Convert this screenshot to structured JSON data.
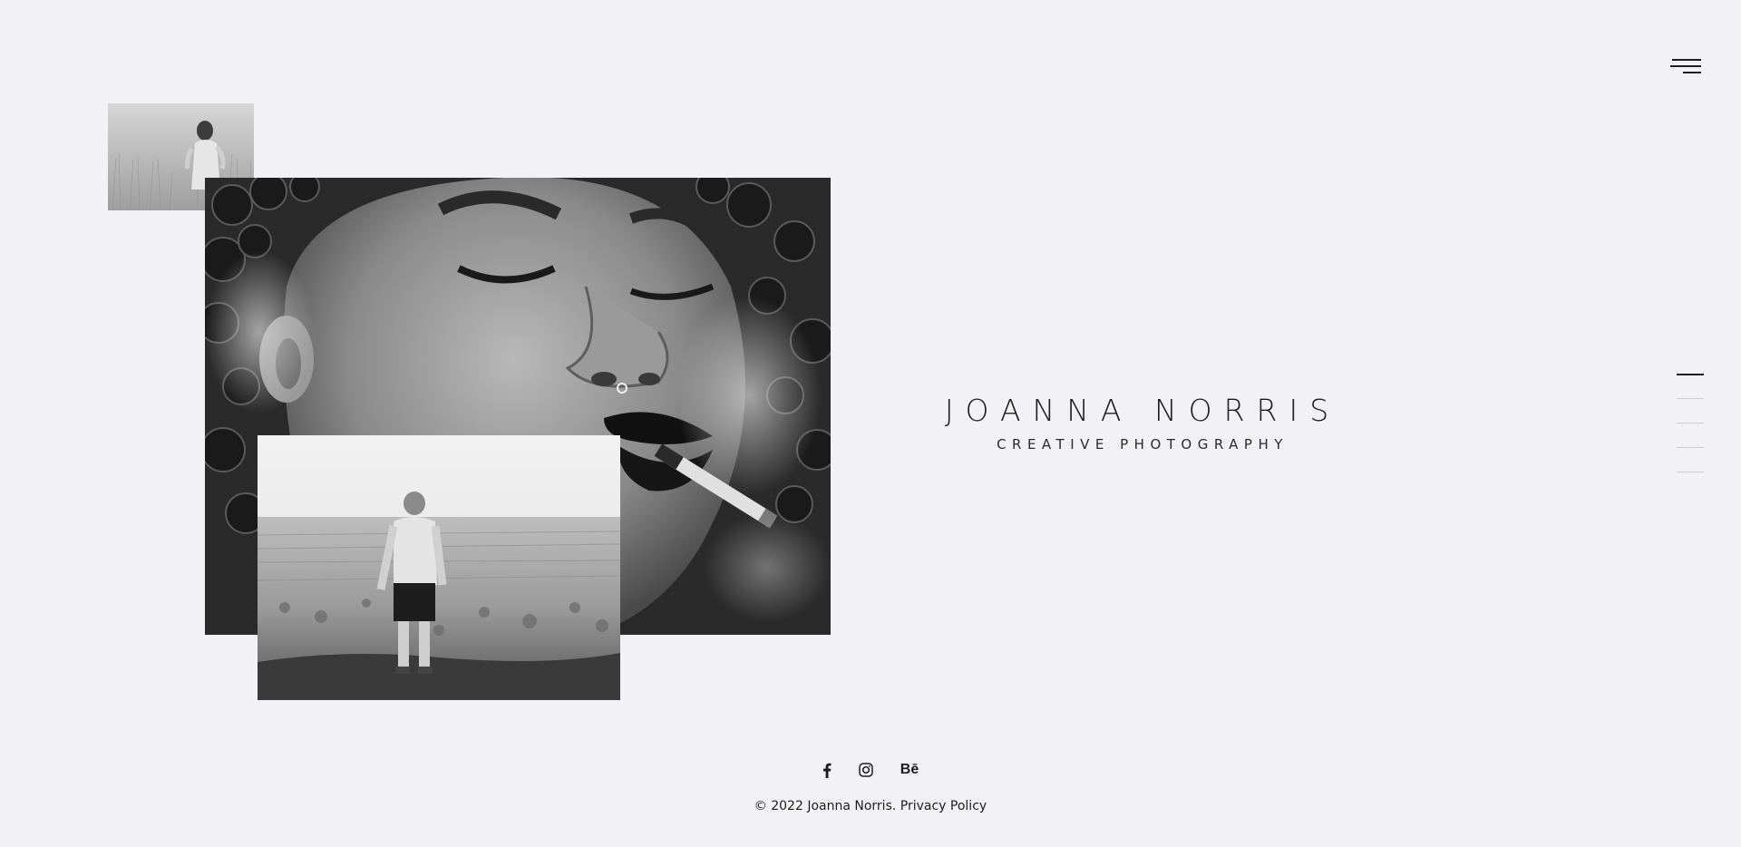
{
  "brand": {
    "name": "JOANNA NORRIS",
    "tagline": "CREATIVE PHOTOGRAPHY"
  },
  "menu": {
    "icon": "hamburger-menu-icon"
  },
  "pager": {
    "count": 5,
    "active_index": 0
  },
  "social": [
    {
      "name": "facebook",
      "icon": "facebook-icon"
    },
    {
      "name": "instagram",
      "icon": "instagram-icon"
    },
    {
      "name": "behance",
      "icon": "behance-icon",
      "glyph": "Bē"
    }
  ],
  "footer": {
    "copyright_prefix": "©  2022 Joanna Norris. ",
    "privacy_link": "Privacy Policy"
  },
  "colors": {
    "background": "#f2f2f4",
    "text": "#1d1d1f",
    "pager_inactive": "#cfcfd3"
  }
}
